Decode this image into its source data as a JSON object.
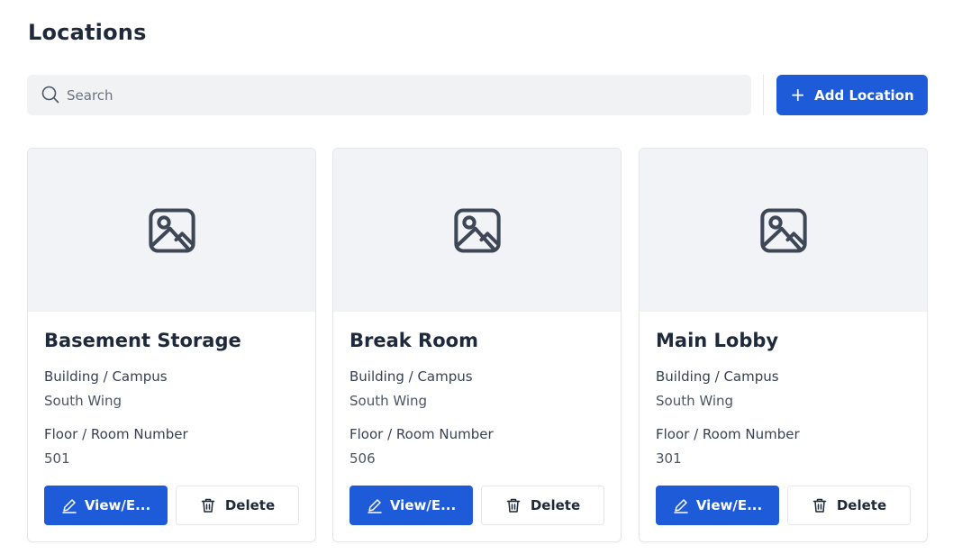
{
  "page": {
    "title": "Locations"
  },
  "toolbar": {
    "search_placeholder": "Search",
    "add_label": "Add Location",
    "add_icon": "plus-icon"
  },
  "colors": {
    "primary": "#1d5bd8",
    "image_bg": "#f2f3f6",
    "search_bg": "#f1f2f4"
  },
  "cards": [
    {
      "name": "Basement Storage",
      "building_label": "Building / Campus",
      "building_value": "South Wing",
      "floor_label": "Floor / Room Number",
      "floor_value": "501",
      "view_label": "View/E...",
      "delete_label": "Delete"
    },
    {
      "name": "Break Room",
      "building_label": "Building / Campus",
      "building_value": "South Wing",
      "floor_label": "Floor / Room Number",
      "floor_value": "506",
      "view_label": "View/E...",
      "delete_label": "Delete"
    },
    {
      "name": "Main Lobby",
      "building_label": "Building / Campus",
      "building_value": "South Wing",
      "floor_label": "Floor / Room Number",
      "floor_value": "301",
      "view_label": "View/E...",
      "delete_label": "Delete"
    }
  ]
}
